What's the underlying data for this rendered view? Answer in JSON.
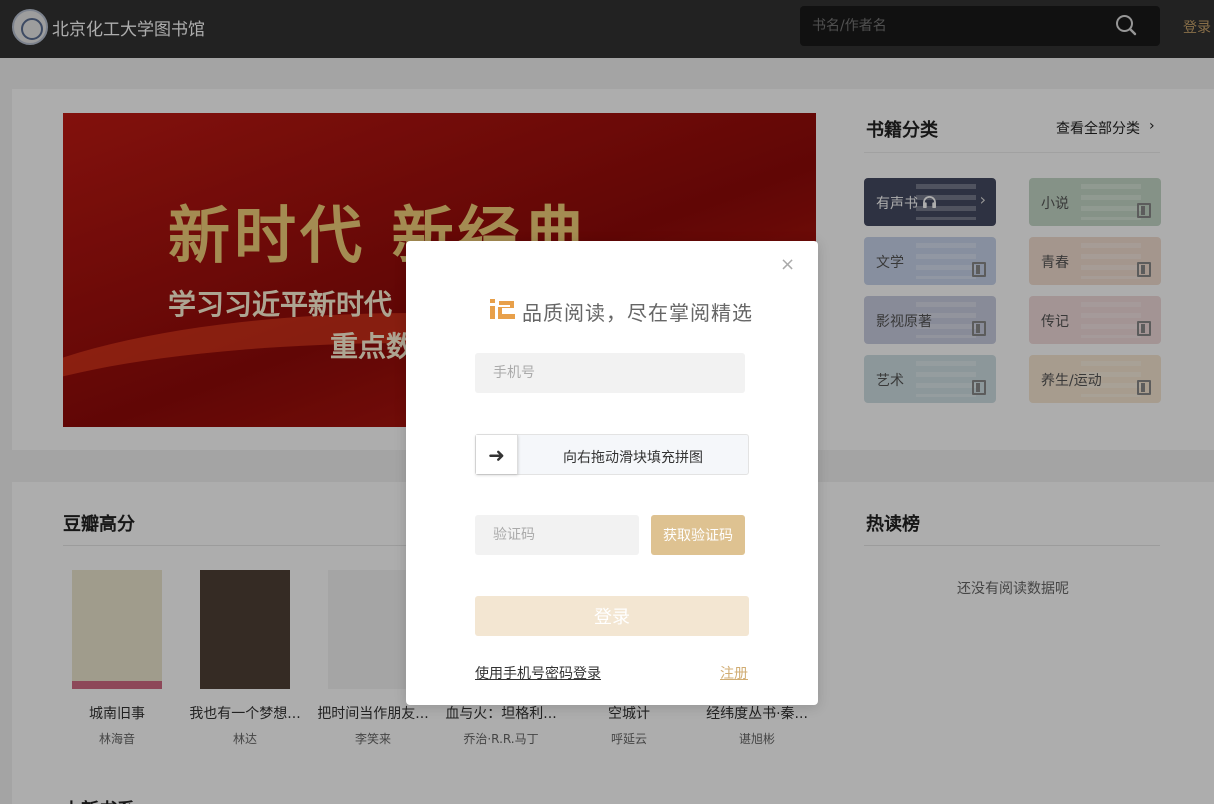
{
  "header": {
    "site_title": "北京化工大学图书馆",
    "search_placeholder": "书名/作者名",
    "login_label": "登录"
  },
  "banner": {
    "title": "新时代   新经典",
    "line1": "学习习近平新时代",
    "line2": "重点数"
  },
  "categories": {
    "heading": "书籍分类",
    "view_all": "查看全部分类",
    "view_all_chevron": "›",
    "items": [
      {
        "label": "有声书",
        "icon": "headphones-icon",
        "color": "#454a62"
      },
      {
        "label": "小说",
        "icon": "book-icon",
        "color": "#c4d8c7"
      },
      {
        "label": "文学",
        "icon": "book-icon",
        "color": "#c7d3ea"
      },
      {
        "label": "青春",
        "icon": "book-icon",
        "color": "#f2ddd0"
      },
      {
        "label": "影视原著",
        "icon": "book-icon",
        "color": "#c9cde0"
      },
      {
        "label": "传记",
        "icon": "book-icon",
        "color": "#f0dada"
      },
      {
        "label": "艺术",
        "icon": "book-icon",
        "color": "#cfdfe3"
      },
      {
        "label": "养生/运动",
        "icon": "book-icon",
        "color": "#f6e6d2"
      }
    ]
  },
  "douban": {
    "heading": "豆瓣高分",
    "books": [
      {
        "title": "城南旧事",
        "author": "林海音",
        "cover_color": "#ece6cf"
      },
      {
        "title": "我也有一个梦想...",
        "author": "林达",
        "cover_color": "#4f4036"
      },
      {
        "title": "把时间当作朋友...",
        "author": "李笑来",
        "cover_color": "#f3f3f3"
      },
      {
        "title": "血与火：坦格利...",
        "author": "乔治·R.R.马丁",
        "cover_color": "#2f2f2f"
      },
      {
        "title": "空城计",
        "author": "呼延云",
        "cover_color": "#444"
      },
      {
        "title": "经纬度丛书·秦...",
        "author": "谌旭彬",
        "cover_color": "#8c6d50"
      }
    ]
  },
  "hot": {
    "heading": "热读榜",
    "empty_text": "还没有阅读数据呢"
  },
  "next_section": {
    "heading": "上新书系"
  },
  "modal": {
    "close_symbol": "×",
    "slogan": "品质阅读，尽在掌阅精选",
    "phone_placeholder": "手机号",
    "slider_arrow": "➜",
    "slider_hint": "向右拖动滑块填充拼图",
    "code_placeholder": "验证码",
    "get_code_label": "获取验证码",
    "login_label": "登录",
    "pwd_login_label": "使用手机号密码登录",
    "register_label": "注册",
    "accent_color": "#dec291"
  }
}
